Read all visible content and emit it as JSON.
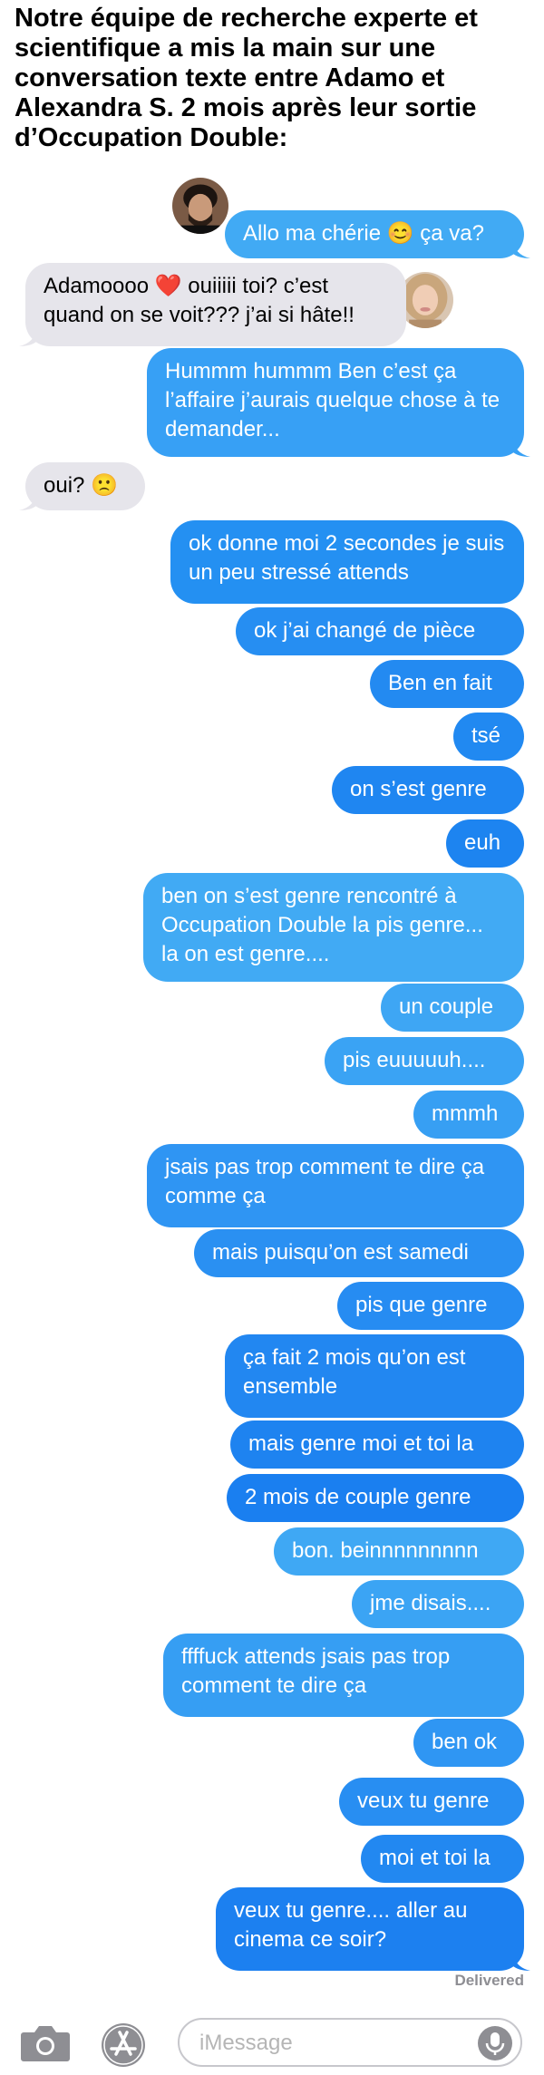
{
  "header": {
    "caption": "Notre équipe de recherche experte et scientifique a mis la main sur une conversation texte entre Adamo et Alexandra S. 2 mois après leur sortie d’Occupation Double:"
  },
  "messages": [
    {
      "side": "out",
      "text": "Allo ma chérie 😊 ça va?",
      "color": "#41aaf4"
    },
    {
      "side": "in",
      "text": "Adamoooo ❤️ ouiiiii toi? c’est quand on se voit??? j’ai si hâte!!",
      "color": "#e6e5eb"
    },
    {
      "side": "out",
      "text": "Hummm hummm Ben c’est ça l’affaire j’aurais quelque chose à te demander...",
      "color": "#37a0f5"
    },
    {
      "side": "in",
      "text": "oui? 🙁",
      "color": "#e6e5eb"
    },
    {
      "side": "out",
      "text": "ok donne moi 2 secondes je suis un peu stressé attends",
      "color": "#2490f2"
    },
    {
      "side": "out",
      "text": "ok j’ai changé de pièce",
      "color": "#268ef2"
    },
    {
      "side": "out",
      "text": "Ben en fait",
      "color": "#238af1"
    },
    {
      "side": "out",
      "text": "tsé",
      "color": "#2189f1"
    },
    {
      "side": "out",
      "text": "on s’est genre",
      "color": "#1f86f1"
    },
    {
      "side": "out",
      "text": "euh",
      "color": "#1d84f0"
    },
    {
      "side": "out",
      "text": "ben on s’est genre rencontré à Occupation Double la pis genre... la on est genre....",
      "color": "#41aaf4"
    },
    {
      "side": "out",
      "text": "un couple",
      "color": "#3ea6f4"
    },
    {
      "side": "out",
      "text": "pis euuuuuh....",
      "color": "#3aa3f4"
    },
    {
      "side": "out",
      "text": "mmmh",
      "color": "#379ff3"
    },
    {
      "side": "out",
      "text": "jsais pas trop comment te dire ça comme ça",
      "color": "#2f95f3"
    },
    {
      "side": "out",
      "text": "mais puisqu’on est samedi",
      "color": "#2a90f2"
    },
    {
      "side": "out",
      "text": "pis que genre",
      "color": "#268cf2"
    },
    {
      "side": "out",
      "text": "ça fait 2 mois qu’on est ensemble",
      "color": "#2287f1"
    },
    {
      "side": "out",
      "text": "mais genre moi et toi la",
      "color": "#1e83f0"
    },
    {
      "side": "out",
      "text": "2 mois de couple genre",
      "color": "#1a7ff0"
    },
    {
      "side": "out",
      "text": "bon. beinnnnnnnnn",
      "color": "#3fa8f4"
    },
    {
      "side": "out",
      "text": "jme disais....",
      "color": "#3ba4f4"
    },
    {
      "side": "out",
      "text": "ffffuck attends jsais pas trop comment te dire ça",
      "color": "#369ef3"
    },
    {
      "side": "out",
      "text": "ben ok",
      "color": "#2f96f3"
    },
    {
      "side": "out",
      "text": "veux tu genre",
      "color": "#288ef2"
    },
    {
      "side": "out",
      "text": "moi et toi la",
      "color": "#2288f1"
    },
    {
      "side": "out",
      "text": "veux tu genre.... aller au cinema ce soir?",
      "color": "#1c80f0"
    }
  ],
  "delivered": "Delivered",
  "composer": {
    "placeholder": "iMessage",
    "camera_icon": "camera-icon",
    "appstore_icon": "app-store-icon",
    "mic_icon": "microphone-icon"
  }
}
